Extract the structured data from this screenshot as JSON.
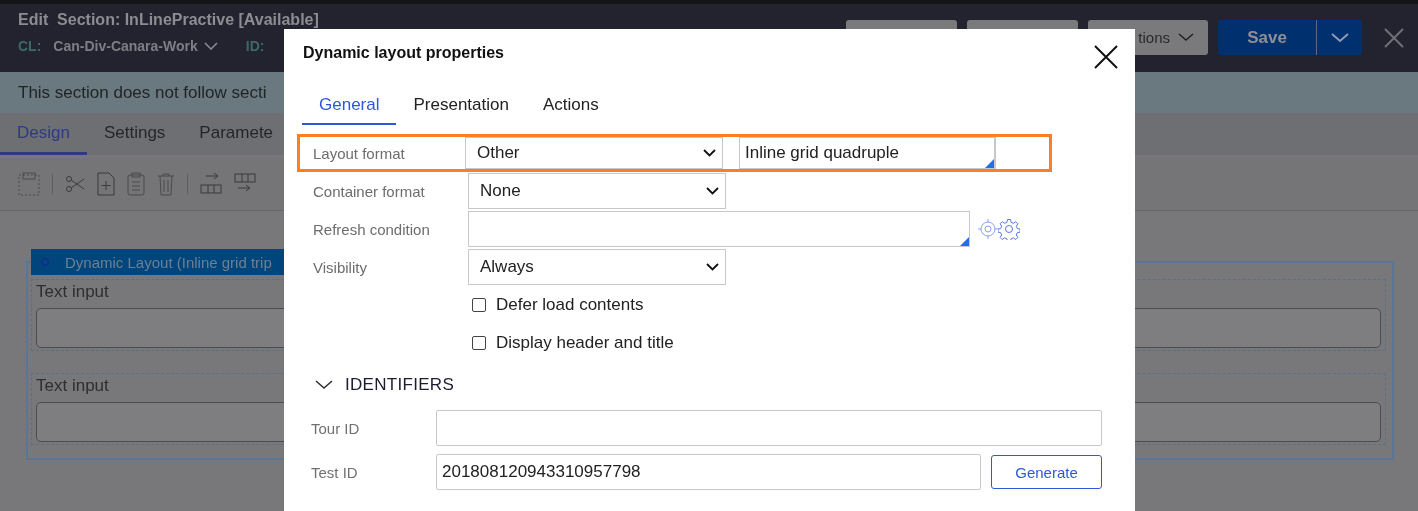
{
  "app_header": {
    "title": "Edit  Section: InLinePractive [Available]",
    "class_label": "CL:",
    "class_value": "Can-Div-Canara-Work",
    "id_label": "ID:",
    "actions_button": "tions",
    "save_button": "Save"
  },
  "notice": "This section does not follow secti",
  "tabs": [
    {
      "label": "Design",
      "selected": true
    },
    {
      "label": "Settings",
      "selected": false
    },
    {
      "label": "Paramete",
      "selected": false
    }
  ],
  "canvas": {
    "layout_header": "Dynamic Layout (Inline grid trip",
    "fields": [
      {
        "label": "Text input"
      },
      {
        "label": "Text input"
      }
    ]
  },
  "dialog": {
    "title": "Dynamic layout properties",
    "tabs": [
      {
        "label": "General",
        "selected": true
      },
      {
        "label": "Presentation",
        "selected": false
      },
      {
        "label": "Actions",
        "selected": false
      }
    ],
    "layout_format": {
      "label": "Layout format",
      "value": "Other",
      "format": "Inline grid quadruple",
      "highlighted": true
    },
    "container_format": {
      "label": "Container format",
      "value": "None"
    },
    "refresh_condition": {
      "label": "Refresh condition"
    },
    "visibility": {
      "label": "Visibility",
      "value": "Always"
    },
    "checkboxes": [
      {
        "label": "Defer load contents",
        "checked": false
      },
      {
        "label": "Display header and title",
        "checked": false
      }
    ],
    "identifiers": {
      "title": "IDENTIFIERS",
      "expanded": true,
      "tour_id": {
        "label": "Tour ID"
      },
      "test_id": {
        "label": "Test ID",
        "value": "201808120943310957798"
      },
      "generate_button": "Generate"
    }
  }
}
